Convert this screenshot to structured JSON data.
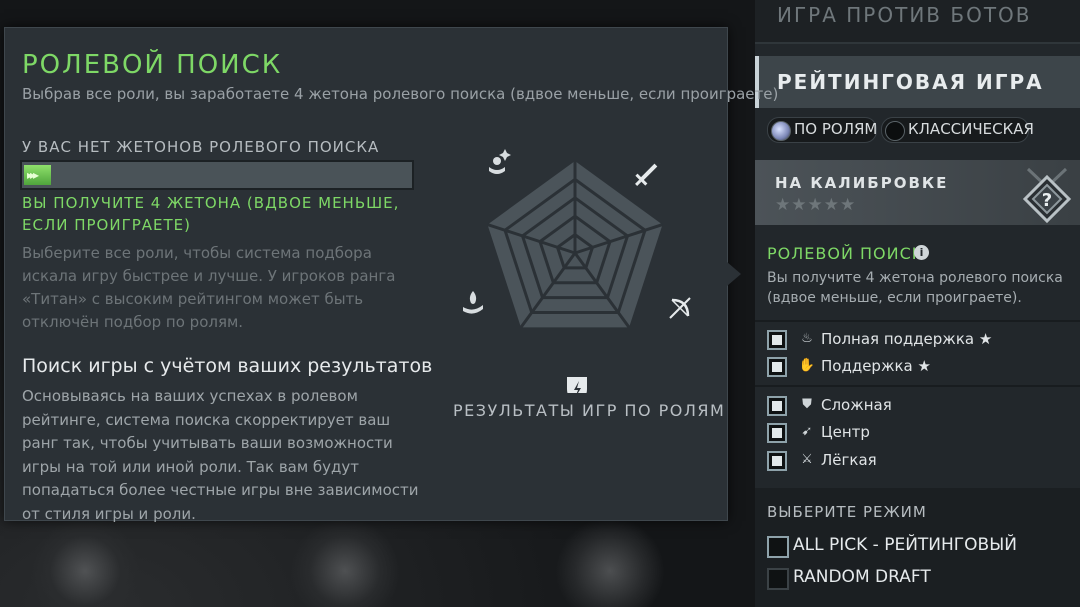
{
  "tooltip": {
    "title": "РОЛЕВОЙ ПОИСК",
    "subtitle": "Выбрав все роли, вы заработаете 4 жетона ролевого поиска (вдвое меньше, если проиграете)",
    "no_tokens": "У ВАС НЕТ ЖЕТОНОВ РОЛЕВОГО ПОИСКА",
    "progress": 0.07,
    "progress_glyph": "▸▸▸",
    "earn_text": "ВЫ ПОЛУЧИТЕ 4 ЖЕТОНА (ВДВОЕ МЕНЬШЕ, ЕСЛИ ПРОИГРАЕТЕ)",
    "description": "Выберите все роли, чтобы система подбора искала игру быстрее и лучше. У игроков ранга «Титан» с высоким рейтингом может быть отключён подбор по ролям.",
    "results_heading": "Поиск игры с учётом ваших результатов",
    "results_text": "Основываясь на ваших успехах в ролевом рейтинге, система поиска скорректирует ваш ранг так, чтобы учитывать ваши возможности игры на той или иной роли. Так вам будут попадаться более честные игры вне зависимости от стиля игры и роли.",
    "chart_label": "РЕЗУЛЬТАТЫ ИГР ПО РОЛЯМ",
    "chart_icons": [
      "hard-support-icon",
      "carry-sword-icon",
      "mid-bow-icon",
      "offlane-shield-icon",
      "support-hand-icon"
    ]
  },
  "right_panel": {
    "bot_match": "ИГРА ПРОТИВ БОТОВ",
    "ranked": "РЕЙТИНГОВАЯ ИГРА",
    "radio_roles": "ПО РОЛЯМ",
    "radio_classic": "КЛАССИЧЕСКАЯ",
    "calibration_title": "НА КАЛИБРОВКЕ",
    "calibration_stars": "★★★★★",
    "medal_symbol": "?",
    "role_search_title": "РОЛЕВОЙ ПОИСК",
    "role_search_desc": "Вы получите 4 жетона ролевого поиска (вдвое меньше, если проиграете).",
    "roles": [
      {
        "label": "Полная поддержка ★",
        "icon": "hard-support-icon"
      },
      {
        "label": "Поддержка ★",
        "icon": "support-icon"
      },
      {
        "label": "Сложная",
        "icon": "offlane-icon"
      },
      {
        "label": "Центр",
        "icon": "mid-icon"
      },
      {
        "label": "Лёгкая",
        "icon": "carry-icon"
      }
    ],
    "mode_title": "ВЫБЕРИТЕ РЕЖИМ",
    "modes": [
      {
        "label": "ALL PICK - РЕЙТИНГОВЫЙ",
        "checked": true
      },
      {
        "label": "RANDOM DRAFT",
        "checked": false
      }
    ]
  },
  "colors": {
    "accent_green": "#7ed866",
    "panel_bg": "#2b3136",
    "radar_fill": "#4b545a"
  }
}
